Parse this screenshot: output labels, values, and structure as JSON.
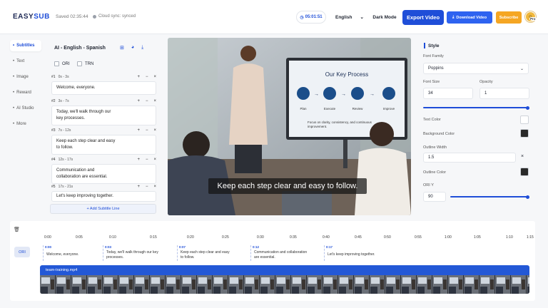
{
  "header": {
    "logo_left": "EASY",
    "logo_right": "SUB",
    "saved": "Saved 02:35:44",
    "sync": "Cloud sync: synced",
    "timer": "05:01:51",
    "language": "English",
    "dark_mode": "Dark Mode",
    "export": "Export Video",
    "download": "Download Video",
    "subscribe": "Subscribe",
    "badge": "Pro"
  },
  "nav": {
    "items": [
      {
        "label": "Subtitles",
        "active": true
      },
      {
        "label": "Text"
      },
      {
        "label": "Image"
      },
      {
        "label": "Reward"
      },
      {
        "label": "AI Studio"
      },
      {
        "label": "More"
      }
    ]
  },
  "subtitles": {
    "title": "AI - English - Spanish",
    "ori": "ORI",
    "trn": "TRN",
    "entries": [
      {
        "num": "#1",
        "time": "0s - 3s",
        "text": "Welcome, everyone."
      },
      {
        "num": "#2",
        "time": "3s - 7s",
        "text": "Today, we'll walk through our key processes."
      },
      {
        "num": "#3",
        "time": "7s - 12s",
        "text": "Keep each step clear and easy to follow."
      },
      {
        "num": "#4",
        "time": "12s - 17s",
        "text": "Communication and collaboration are essential."
      },
      {
        "num": "#5",
        "time": "17s - 21s",
        "text": "Let's keep improving together."
      }
    ],
    "add_line": "+ Add Subtitle Line"
  },
  "video": {
    "caption": "Keep each step clear and easy to follow.",
    "screen_title": "Our Key Process",
    "screen_steps": [
      "Plan",
      "Execute",
      "Review",
      "Improve"
    ],
    "screen_note": "Focus on clarity, consistency, and continuous improvement."
  },
  "style": {
    "title": "Style",
    "font_family_label": "Font Family",
    "font_family": "Poppins",
    "font_size_label": "Font Size",
    "font_size": "34",
    "opacity_label": "Opacity",
    "opacity": "1",
    "text_color_label": "Text Color",
    "text_color": "#ffffff",
    "bg_color_label": "Background Color",
    "bg_color": "#2a2a2a",
    "outline_width_label": "Outline Width",
    "outline_width": "1.5",
    "outline_color_label": "Outline Color",
    "outline_color": "#2a2a2a",
    "ori_y_label": "ORI Y",
    "ori_y": "90"
  },
  "timeline": {
    "ticks": [
      "0:00",
      "0:05",
      "0:10",
      "0:15",
      "0:20",
      "0:25",
      "0:30",
      "0:35",
      "0:40",
      "0:45",
      "0:50",
      "0:55",
      "1:00",
      "1:05",
      "1:10",
      "1:15"
    ],
    "track_label": "ORI",
    "blocks": [
      {
        "ts": "0:00",
        "text": "Welcome, everyone."
      },
      {
        "ts": "0:03",
        "text": "Today, we'll walk through our key processes."
      },
      {
        "ts": "0:07",
        "text": "Keep each step clear and easy to follow."
      },
      {
        "ts": "0:12",
        "text": "Communication and collaboration are essential."
      },
      {
        "ts": "0:17",
        "text": "Let's keep improving together."
      }
    ],
    "video_file": "team-training.mp4"
  }
}
